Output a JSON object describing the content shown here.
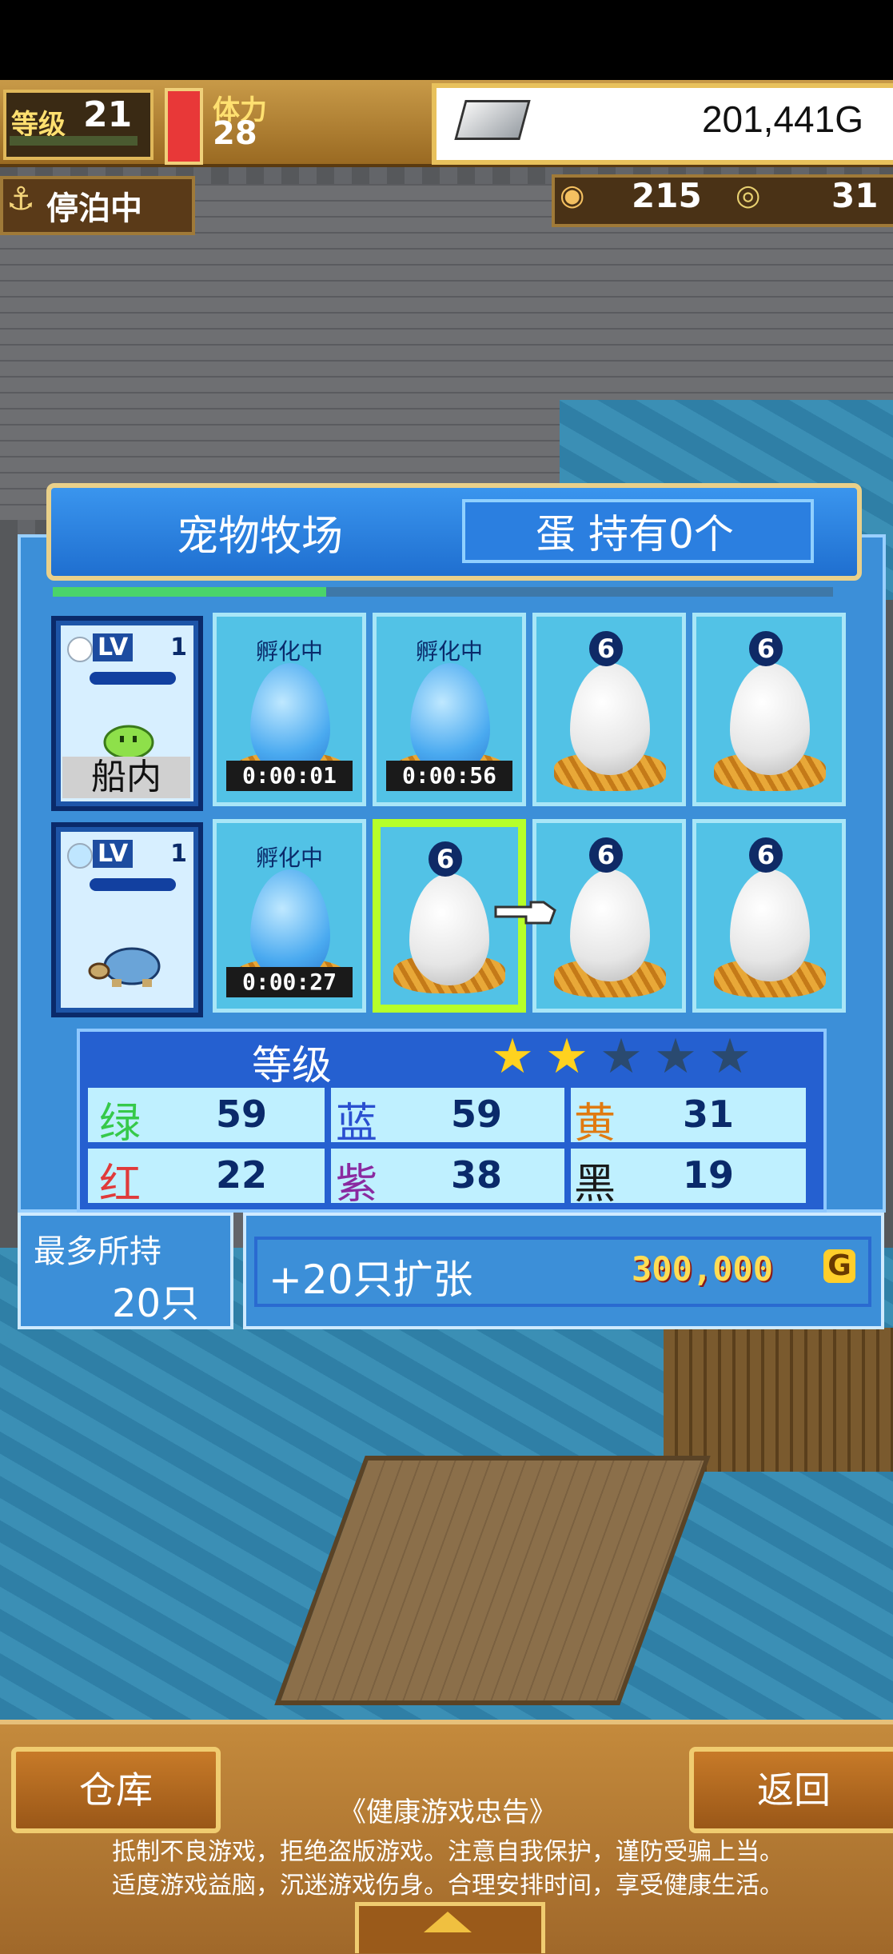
{
  "hud": {
    "level_label": "等级",
    "level_value": "21",
    "stamina_label": "体力",
    "stamina_value": "28",
    "gold_value": "201,441G",
    "dock_status": "停泊中",
    "resource_1": "215",
    "resource_2": "31"
  },
  "panel": {
    "title": "宠物牧场",
    "egg_status": "蛋 持有0个",
    "progress": 0.35
  },
  "pets": [
    {
      "lv_label": "LV",
      "lv_num": "1",
      "location": "船内",
      "kind": "green-slime"
    },
    {
      "lv_label": "LV",
      "lv_num": "1",
      "location": "",
      "kind": "blue-turtle"
    }
  ],
  "slots": [
    [
      {
        "label": "孵化中",
        "egg": "blue",
        "timer": "0:00:01"
      },
      {
        "label": "孵化中",
        "egg": "blue",
        "timer": "0:00:56"
      },
      {
        "badge": "6",
        "egg": "white"
      },
      {
        "badge": "6",
        "egg": "white"
      }
    ],
    [
      {
        "label": "孵化中",
        "egg": "blue",
        "timer": "0:00:27"
      },
      {
        "badge": "6",
        "egg": "white",
        "selected": true
      },
      {
        "badge": "6",
        "egg": "white"
      },
      {
        "badge": "6",
        "egg": "white"
      }
    ]
  ],
  "grade": {
    "label": "等级",
    "stars_filled": 2,
    "stars_total": 5,
    "stats": [
      {
        "name": "绿",
        "value": "59",
        "color": "#36c94a"
      },
      {
        "name": "蓝",
        "value": "59",
        "color": "#2a4fd0"
      },
      {
        "name": "黄",
        "value": "31",
        "color": "#e07a10"
      },
      {
        "name": "红",
        "value": "22",
        "color": "#e03a3a"
      },
      {
        "name": "紫",
        "value": "38",
        "color": "#8a2aa0"
      },
      {
        "name": "黑",
        "value": "19",
        "color": "#1a1a1a"
      }
    ]
  },
  "capacity": {
    "label": "最多所持",
    "value": "20只"
  },
  "expand": {
    "label": "+20只扩张",
    "price": "300,000",
    "currency": "G"
  },
  "bottom": {
    "warehouse_label": "仓库",
    "back_label": "返回",
    "notice_title": "《健康游戏忠告》",
    "notice_line1": "抵制不良游戏，拒绝盗版游戏。注意自我保护，谨防受骗上当。",
    "notice_line2": "适度游戏益脑，沉迷游戏伤身。合理安排时间，享受健康生活。"
  },
  "colors": {
    "panel_blue": "#3c8fd8",
    "gold_border": "#e9d08a",
    "select_green": "#b6ff2a"
  }
}
